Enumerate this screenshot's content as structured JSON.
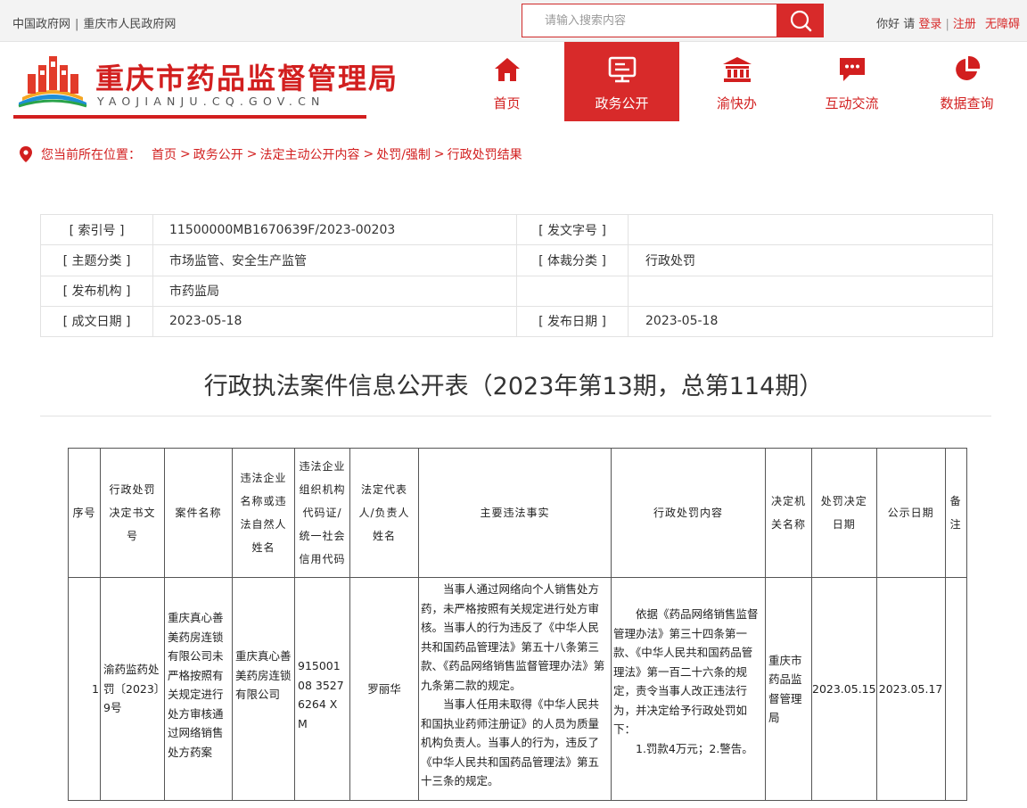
{
  "topbar": {
    "links": [
      "中国政府网",
      "重庆市人民政府网"
    ],
    "search_placeholder": "请输入搜索内容",
    "greeting": "你好",
    "please": "请",
    "login": "登录",
    "register": "注册",
    "accessibility": "无障碍"
  },
  "header": {
    "title": "重庆市药品监督管理局",
    "subtitle": "YAOJIANJU.CQ.GOV.CN",
    "nav": [
      {
        "label": "首页",
        "icon": "home-icon"
      },
      {
        "label": "政务公开",
        "icon": "screen-icon",
        "active": true
      },
      {
        "label": "渝快办",
        "icon": "bank-icon"
      },
      {
        "label": "互动交流",
        "icon": "chat-icon"
      },
      {
        "label": "数据查询",
        "icon": "pie-chart-icon"
      }
    ]
  },
  "breadcrumb": {
    "lead": "您当前所在位置：",
    "items": [
      "首页",
      "政务公开",
      "法定主动公开内容",
      "处罚/强制",
      "行政处罚结果"
    ]
  },
  "meta": {
    "index_label": "[ 索引号 ]",
    "index_value": "11500000MB1670639F/2023-00203",
    "docno_label": "[ 发文字号 ]",
    "docno_value": "",
    "topic_label": "[ 主题分类 ]",
    "topic_value": "市场监管、安全生产监管",
    "genre_label": "[ 体裁分类 ]",
    "genre_value": "行政处罚",
    "org_label": "[ 发布机构 ]",
    "org_value": "市药监局",
    "created_label": "[ 成文日期 ]",
    "created_value": "2023-05-18",
    "published_label": "[ 发布日期 ]",
    "published_value": "2023-05-18"
  },
  "document": {
    "title": "行政执法案件信息公开表（2023年第13期，总第114期）"
  },
  "case_table": {
    "headers": {
      "seq": "序号",
      "decision_no": "行政处罚　决定书文号",
      "case_name": "案件名称",
      "violator": "违法企业名称或违法自然人姓名",
      "org_code": "违法企业组织机构代码证/统一社会信用代码",
      "legal_rep": "法定代表人/负责人姓名",
      "facts": "主要违法事实",
      "penalty": "行政处罚内容",
      "authority": "决定机关名称",
      "decision_date": "处罚决定日期",
      "publish_date": "公示日期",
      "note": "备注"
    },
    "row": {
      "seq": "1",
      "decision_no": "渝药监药处罚〔2023〕9号",
      "case_name": "重庆真心善美药房连锁有限公司未严格按照有关规定进行处方审核通过网络销售处方药案",
      "violator": "重庆真心善美药房连锁有限公司",
      "org_code": "91500108 35276264 XM",
      "legal_rep": "罗丽华",
      "facts_p1": "当事人通过网络向个人销售处方药，未严格按照有关规定进行处方审核。当事人的行为违反了《中华人民共和国药品管理法》第五十八条第三款、《药品网络销售监督管理办法》第九条第二款的规定。",
      "facts_p2": "当事人任用未取得《中华人民共和国执业药师注册证》的人员为质量机构负责人。当事人的行为，违反了《中华人民共和国药品管理法》第五十三条的规定。",
      "penalty_p1": "依据《药品网络销售监督管理办法》第三十四条第一款、《中华人民共和国药品管理法》第一百二十六条的规定，责令当事人改正违法行为，并决定给予行政处罚如下：",
      "penalty_p2": "1.罚款4万元；2.警告。",
      "authority": "重庆市药品监督管理局",
      "decision_date": "2023.05.15",
      "publish_date": "2023.05.17",
      "note": ""
    }
  },
  "colors": {
    "brand_red": "#d21f1f",
    "nav_active": "#d82a2a"
  }
}
